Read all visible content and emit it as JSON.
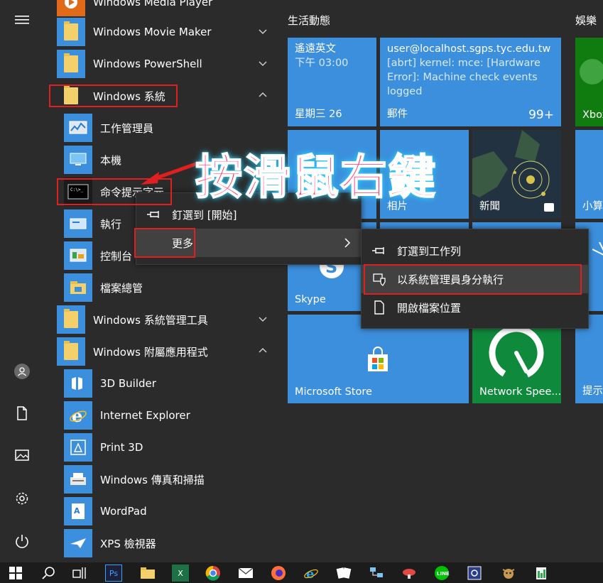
{
  "rail": {
    "items": [
      {
        "name": "hamburger-menu-icon"
      },
      {
        "name": "user-icon"
      },
      {
        "name": "documents-icon"
      },
      {
        "name": "pictures-icon"
      },
      {
        "name": "settings-icon"
      },
      {
        "name": "power-icon"
      }
    ]
  },
  "applist": {
    "items": [
      {
        "label": "Windows Media Player"
      },
      {
        "label": "Windows Movie Maker"
      },
      {
        "label": "Windows PowerShell"
      },
      {
        "label": "Windows 系統"
      },
      {
        "label": "工作管理員"
      },
      {
        "label": "本機"
      },
      {
        "label": "命令提示字元"
      },
      {
        "label": "執行"
      },
      {
        "label": "控制台"
      },
      {
        "label": "檔案總管"
      },
      {
        "label": "Windows 系統管理工具"
      },
      {
        "label": "Windows 附屬應用程式"
      },
      {
        "label": "3D Builder"
      },
      {
        "label": "Internet Explorer"
      },
      {
        "label": "Print 3D"
      },
      {
        "label": "Windows 傳真和掃描"
      },
      {
        "label": "WordPad"
      },
      {
        "label": "XPS 檢視器"
      }
    ]
  },
  "groups": {
    "live": "生活動態",
    "entertainment": "娛樂"
  },
  "tiles": {
    "calendar": {
      "line1": "遙遠英文",
      "line2": "下午 03:00",
      "name": "星期三 26"
    },
    "mail": {
      "line1": "user@localhost.sgps.tyc.edu.tw",
      "line2": "[abrt] kernel: mce: [Hardware",
      "line3": "Error]: Machine check events",
      "line4": "logged",
      "name": "郵件",
      "count": "99+"
    },
    "xbox": {
      "name": "Xbox"
    },
    "photos": {
      "name": "相片"
    },
    "news": {
      "name": "新聞"
    },
    "small": {
      "name": "小算"
    },
    "skype": {
      "name": "Skype"
    },
    "store": {
      "name": "Microsoft Store"
    },
    "speedtest": {
      "name": "Network Spee..."
    },
    "tips": {
      "name": "提示"
    }
  },
  "context_menu": {
    "pin_start": "釘選到 [開始]",
    "more": "更多"
  },
  "submenu": {
    "pin_taskbar": "釘選到工作列",
    "run_admin": "以系統管理員身分執行",
    "open_location": "開啟檔案位置"
  },
  "annotation": "按滑鼠右鍵",
  "colors": {
    "tile_blue": "#3c8fdc",
    "xbox_green": "#107c10",
    "speedtest_green": "#0f8a3c",
    "highlight_red": "#e02020"
  }
}
